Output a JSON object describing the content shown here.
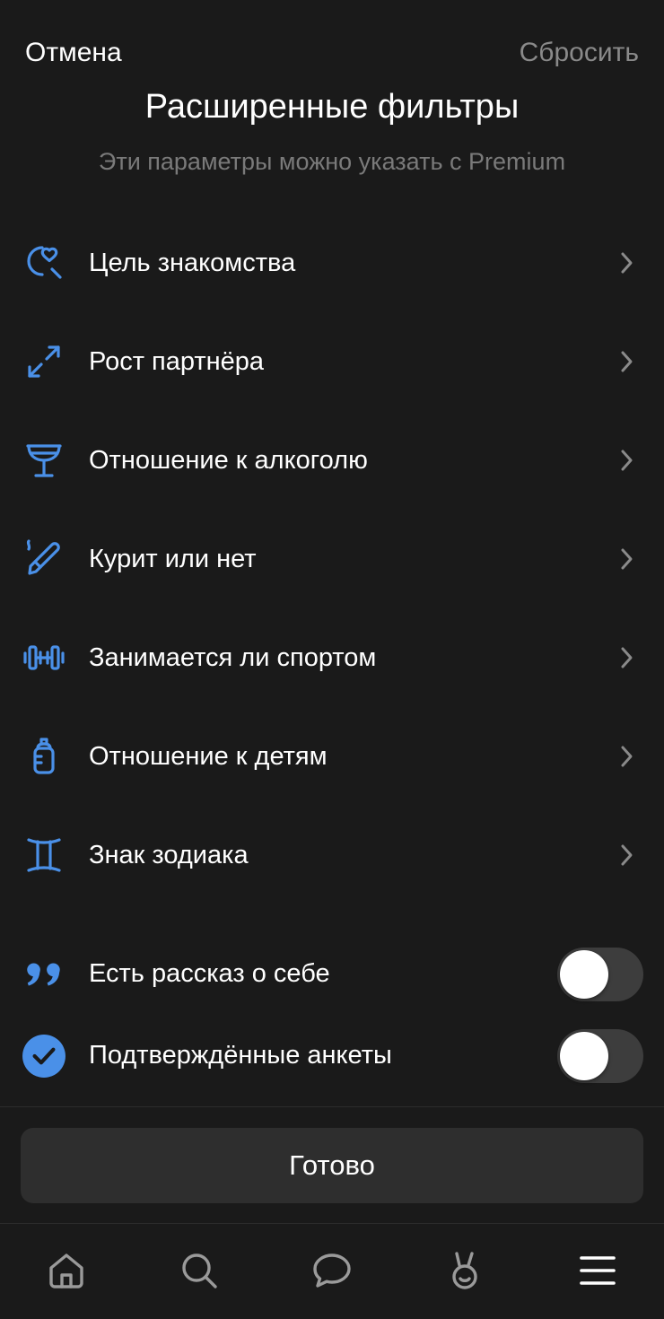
{
  "header": {
    "cancel_label": "Отмена",
    "reset_label": "Сбросить",
    "title": "Расширенные фильтры",
    "subtitle": "Эти параметры можно указать с Premium"
  },
  "colors": {
    "accent": "#4a90e8",
    "background": "#1a1a1a",
    "muted_text": "#7a7a7a",
    "button_bg": "#2e2e2e"
  },
  "filters": [
    {
      "label": "Цель знакомства",
      "icon": "heart-search-icon"
    },
    {
      "label": "Рост партнёра",
      "icon": "expand-arrows-icon"
    },
    {
      "label": "Отношение к алкоголю",
      "icon": "wine-glass-icon"
    },
    {
      "label": "Курит или нет",
      "icon": "cigarette-icon"
    },
    {
      "label": "Занимается ли спортом",
      "icon": "dumbbell-icon"
    },
    {
      "label": "Отношение к детям",
      "icon": "baby-bottle-icon"
    },
    {
      "label": "Знак зодиака",
      "icon": "gemini-icon"
    }
  ],
  "toggles": [
    {
      "label": "Есть рассказ о себе",
      "icon": "quote-icon",
      "on": false
    },
    {
      "label": "Подтверждённые анкеты",
      "icon": "verified-check-icon",
      "on": false
    }
  ],
  "done_label": "Готово",
  "tabbar": [
    {
      "icon": "home-icon"
    },
    {
      "icon": "search-icon"
    },
    {
      "icon": "chat-icon"
    },
    {
      "icon": "bunny-icon"
    },
    {
      "icon": "menu-icon"
    }
  ]
}
